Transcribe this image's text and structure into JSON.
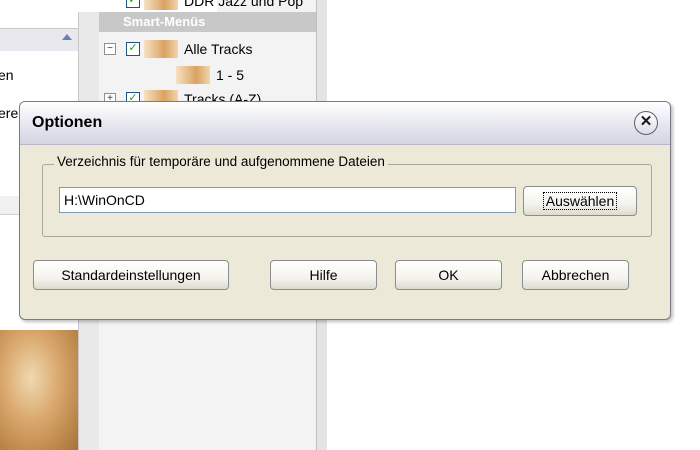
{
  "background": {
    "left_panel": {
      "text_rows": [
        "en",
        "ere"
      ]
    },
    "tree": {
      "top_item": "DDR Jazz und Pop",
      "smart_menus_header": "Smart-Menüs",
      "items": [
        {
          "label": "Alle Tracks",
          "expander": "−",
          "checked": true
        },
        {
          "label": "1 - 5",
          "child": true
        },
        {
          "label": "Tracks (A-Z)",
          "expander": "+",
          "checked": true
        }
      ]
    }
  },
  "dialog": {
    "title": "Optionen",
    "close_glyph": "✕",
    "group_label": "Verzeichnis für temporäre und aufgenommene Dateien",
    "path_value": "H:\\WinOnCD",
    "browse_label": "Auswählen",
    "buttons": {
      "defaults": "Standardeinstellungen",
      "help": "Hilfe",
      "ok": "OK",
      "cancel": "Abbrechen"
    }
  }
}
